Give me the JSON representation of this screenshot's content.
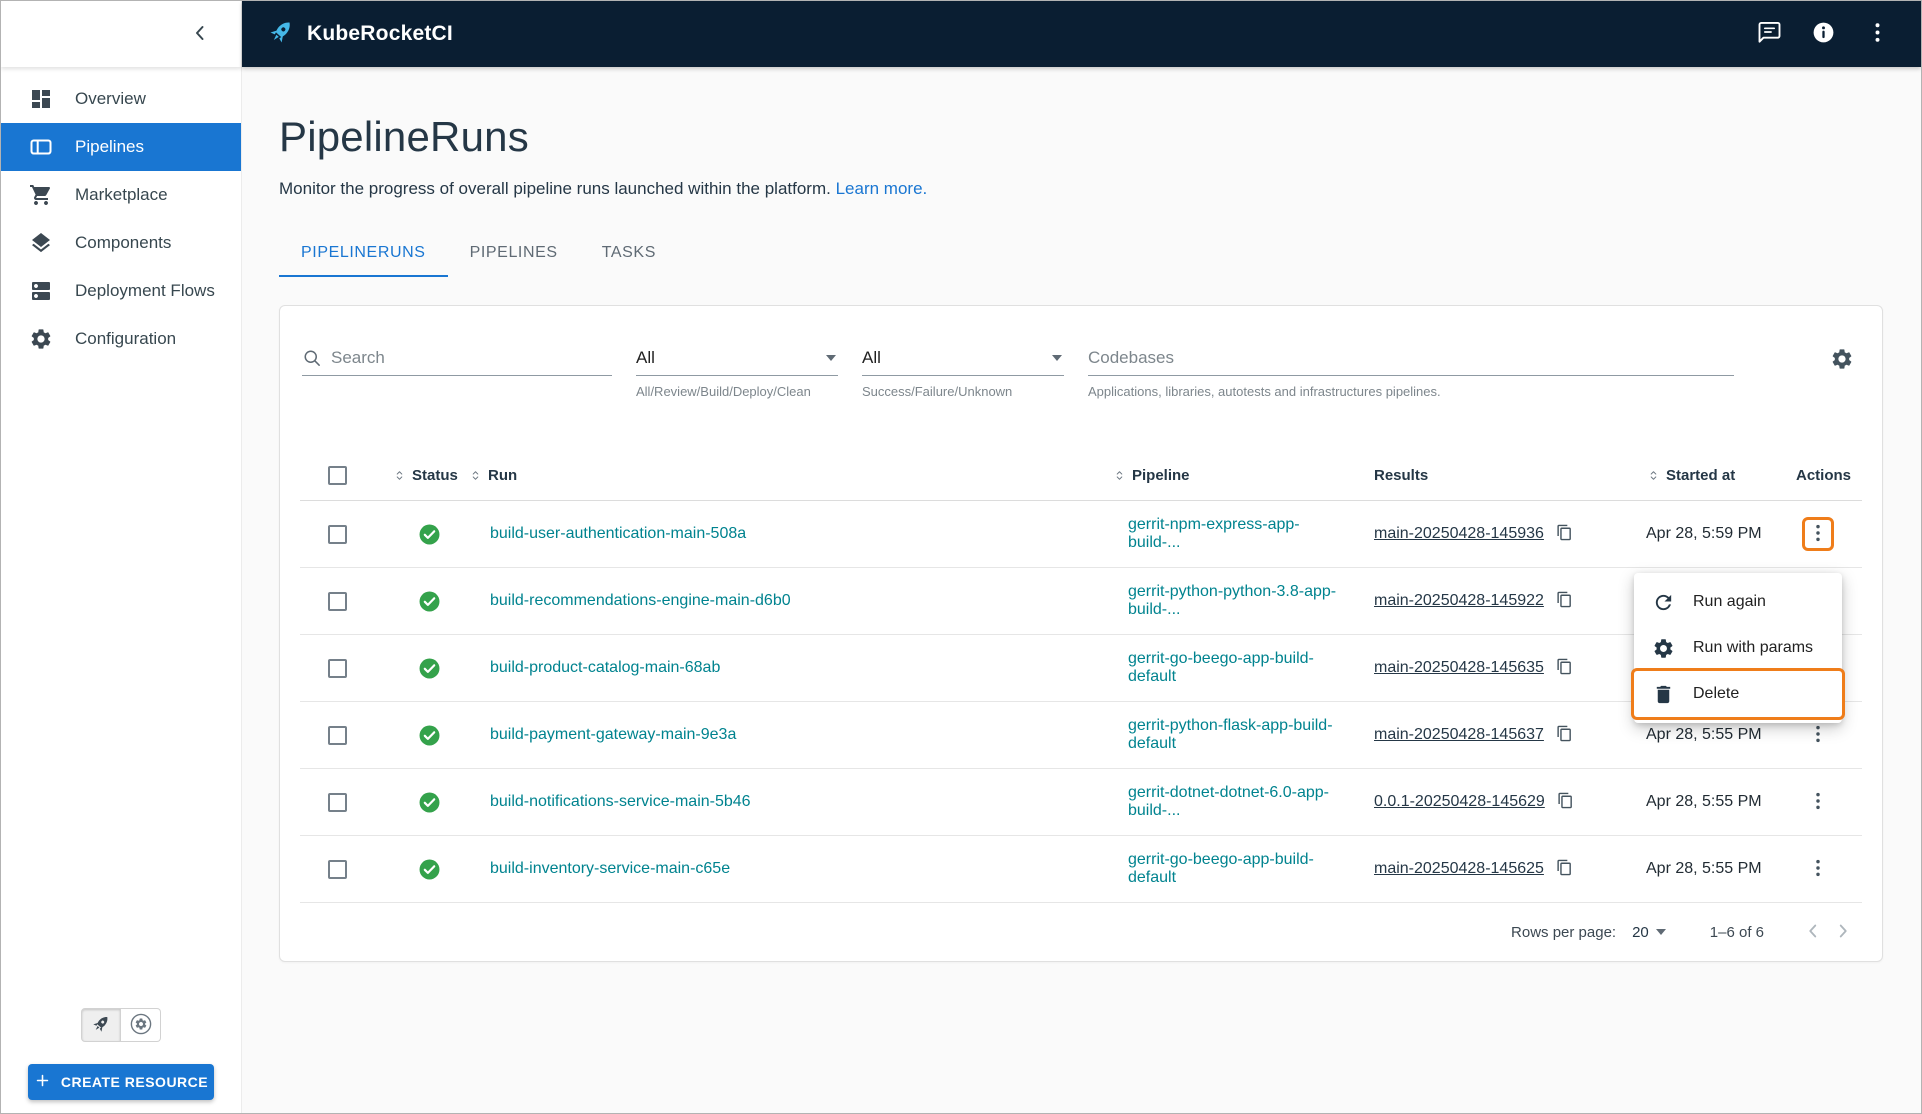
{
  "topbar": {
    "app_name": "KubeRocketCI"
  },
  "sidebar": {
    "items": [
      {
        "label": "Overview",
        "icon": "dashboard-icon",
        "selected": false
      },
      {
        "label": "Pipelines",
        "icon": "pipelines-icon",
        "selected": true
      },
      {
        "label": "Marketplace",
        "icon": "cart-icon",
        "selected": false
      },
      {
        "label": "Components",
        "icon": "layers-icon",
        "selected": false
      },
      {
        "label": "Deployment Flows",
        "icon": "flows-icon",
        "selected": false
      },
      {
        "label": "Configuration",
        "icon": "gear-icon",
        "selected": false
      }
    ],
    "create_button": "CREATE RESOURCE"
  },
  "page": {
    "title": "PipelineRuns",
    "subtitle": "Monitor the progress of overall pipeline runs launched within the platform.",
    "learn_more": "Learn more.",
    "tabs": [
      {
        "label": "PIPELINERUNS",
        "active": true
      },
      {
        "label": "PIPELINES",
        "active": false
      },
      {
        "label": "TASKS",
        "active": false
      }
    ]
  },
  "filters": {
    "search_placeholder": "Search",
    "type_filter": {
      "value": "All",
      "helper": "All/Review/Build/Deploy/Clean"
    },
    "status_filter": {
      "value": "All",
      "helper": "Success/Failure/Unknown"
    },
    "codebases_filter": {
      "placeholder": "Codebases",
      "helper": "Applications, libraries, autotests and infrastructures pipelines."
    }
  },
  "table": {
    "columns": {
      "status": "Status",
      "run": "Run",
      "pipeline": "Pipeline",
      "results": "Results",
      "started": "Started at",
      "actions": "Actions"
    },
    "rows": [
      {
        "status": "success",
        "run": "build-user-authentication-main-508a",
        "pipeline": "gerrit-npm-express-app-build-...",
        "result": "main-20250428-145936",
        "started": "Apr 28, 5:59 PM"
      },
      {
        "status": "success",
        "run": "build-recommendations-engine-main-d6b0",
        "pipeline": "gerrit-python-python-3.8-app-build-...",
        "result": "main-20250428-145922",
        "started": ""
      },
      {
        "status": "success",
        "run": "build-product-catalog-main-68ab",
        "pipeline": "gerrit-go-beego-app-build-default",
        "result": "main-20250428-145635",
        "started": ""
      },
      {
        "status": "success",
        "run": "build-payment-gateway-main-9e3a",
        "pipeline": "gerrit-python-flask-app-build-default",
        "result": "main-20250428-145637",
        "started": "Apr 28, 5:55 PM"
      },
      {
        "status": "success",
        "run": "build-notifications-service-main-5b46",
        "pipeline": "gerrit-dotnet-dotnet-6.0-app-build-...",
        "result": "0.0.1-20250428-145629",
        "started": "Apr 28, 5:55 PM"
      },
      {
        "status": "success",
        "run": "build-inventory-service-main-c65e",
        "pipeline": "gerrit-go-beego-app-build-default",
        "result": "main-20250428-145625",
        "started": "Apr 28, 5:55 PM"
      }
    ]
  },
  "context_menu": {
    "items": [
      {
        "label": "Run again",
        "icon": "refresh-icon",
        "highlighted": false
      },
      {
        "label": "Run with params",
        "icon": "params-gear-icon",
        "highlighted": false
      },
      {
        "label": "Delete",
        "icon": "trash-icon",
        "highlighted": true
      }
    ]
  },
  "pagination": {
    "rows_per_page_label": "Rows per page:",
    "rows_per_page": "20",
    "range": "1–6 of 6"
  },
  "colors": {
    "accent_blue": "#1976d2",
    "header_navy": "#0a1e32",
    "link_teal": "#00838f",
    "success_green": "#34a24b",
    "highlight_orange": "#ef7d1a"
  }
}
